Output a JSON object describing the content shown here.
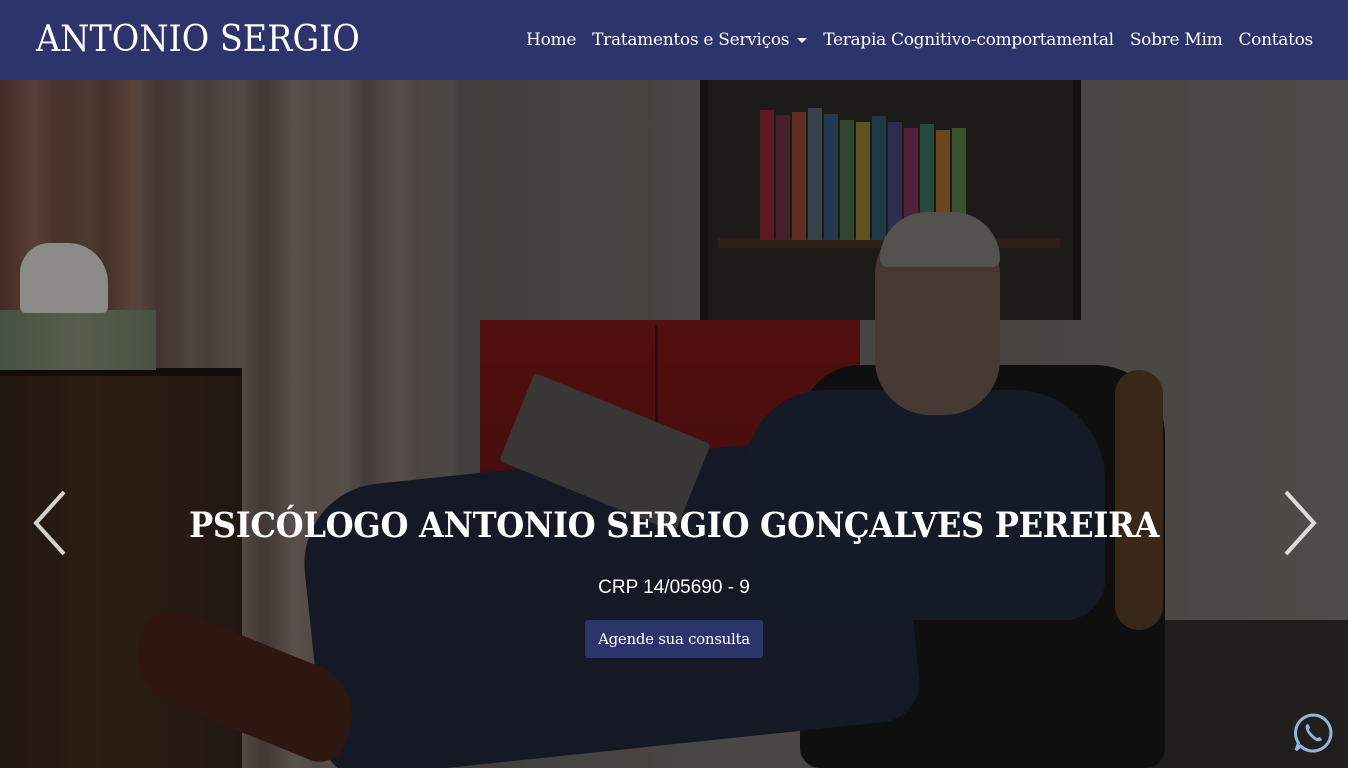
{
  "header": {
    "brand": "ANTONIO SERGIO",
    "nav": [
      {
        "label": "Home"
      },
      {
        "label": "Tratamentos e Serviços",
        "dropdown": true
      },
      {
        "label": "Terapia Cognitivo-comportamental"
      },
      {
        "label": "Sobre Mim"
      },
      {
        "label": "Contatos"
      }
    ],
    "background_color": "#2d336b"
  },
  "hero": {
    "title": "PSICÓLOGO ANTONIO SERGIO GONÇALVES PEREIRA",
    "subtitle": "CRP 14/05690 - 9",
    "cta_label": "Agende sua consulta",
    "prev_icon": "chevron-left-icon",
    "next_icon": "chevron-right-icon"
  },
  "floating": {
    "whatsapp_icon": "whatsapp-icon"
  }
}
